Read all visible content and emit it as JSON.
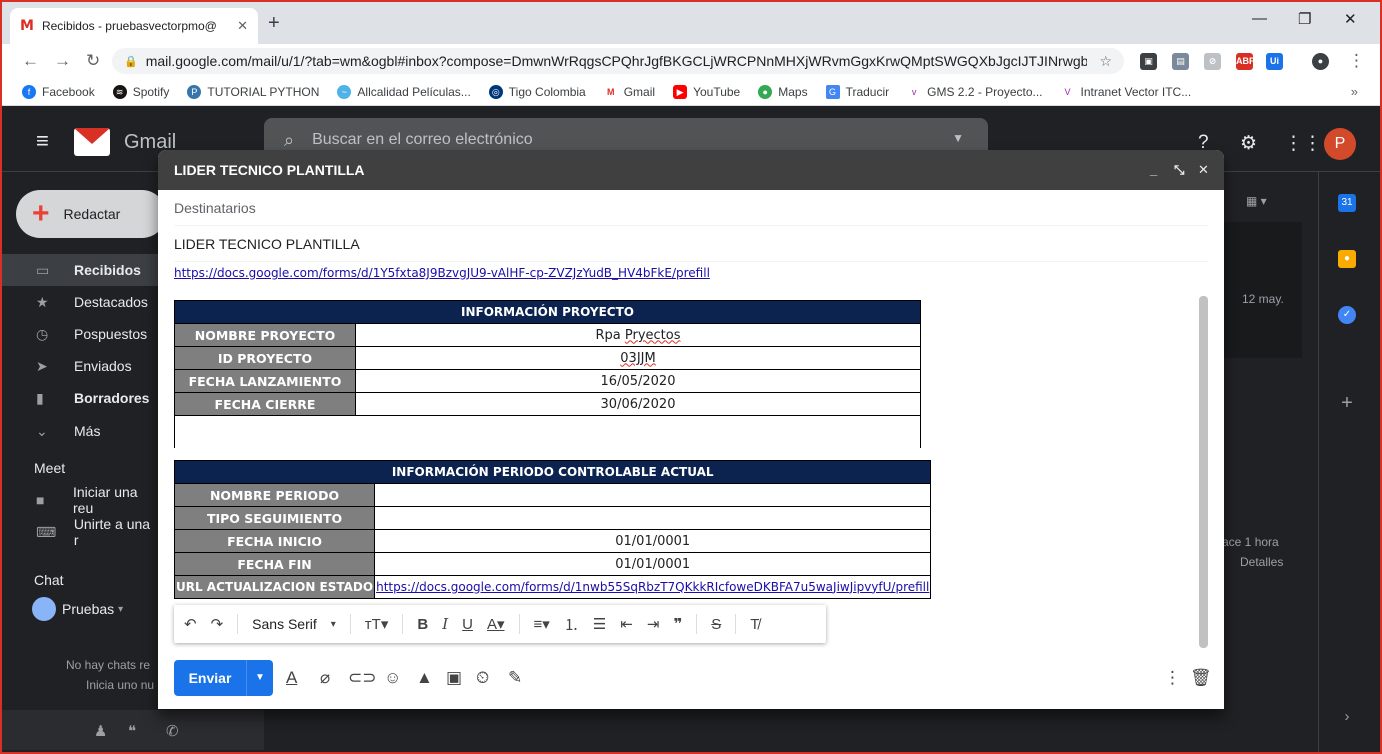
{
  "browser": {
    "tab_title": "Recibidos - pruebasvectorpmo@",
    "url": "mail.google.com/mail/u/1/?tab=wm&ogbl#inbox?compose=DmwnWrRqgsCPQhrJgfBKGCLjWRCPNnMHXjWRvmGgxKrwQMptSWGQXbJgcIJTJINrwgb...",
    "bookmarks": [
      "Facebook",
      "Spotify",
      "TUTORIAL PYTHON",
      "Allcalidad Películas...",
      "Tigo Colombia",
      "Gmail",
      "YouTube",
      "Maps",
      "Traducir",
      "GMS 2.2 - Proyecto...",
      "Intranet Vector ITC..."
    ],
    "bookmarks_more": "»"
  },
  "gmail": {
    "logo_text": "Gmail",
    "search_placeholder": "Buscar en el correo electrónico",
    "avatar_letter": "P",
    "compose_label": "Redactar",
    "nav": [
      "Recibidos",
      "Destacados",
      "Pospuestos",
      "Enviados",
      "Borradores",
      "Más"
    ],
    "meet_title": "Meet",
    "meet_items": [
      "Iniciar una reu",
      "Unirte a una r"
    ],
    "chat_title": "Chat",
    "chat_user": "Pruebas",
    "no_chats_1": "No hay chats re",
    "no_chats_2": "Inicia uno nu",
    "mail_date": "12 may.",
    "mail_time": "ace 1 hora",
    "mail_details": "Detalles"
  },
  "compose": {
    "title": "LIDER TECNICO PLANTILLA",
    "to_label": "Destinatarios",
    "subject": "LIDER TECNICO PLANTILLA",
    "top_link": "https://docs.google.com/forms/d/1Y5fxta8J9BzvgJU9-vAlHF-cp-ZVZJzYudB_HV4bFkE/prefill",
    "project_header": "INFORMACIÓN PROYECTO",
    "project_rows": [
      {
        "label": "NOMBRE PROYECTO",
        "value_a": "Rpa ",
        "value_b": "Pryectos"
      },
      {
        "label": "ID PROYECTO",
        "value_a": "",
        "value_b": "03JJM"
      },
      {
        "label": "FECHA LANZAMIENTO",
        "value_a": "16/05/2020",
        "value_b": ""
      },
      {
        "label": "FECHA CIERRE",
        "value_a": "30/06/2020",
        "value_b": ""
      }
    ],
    "period_header": "INFORMACIÓN PERIODO CONTROLABLE ACTUAL",
    "period_rows": [
      {
        "label": "NOMBRE PERIODO",
        "value": ""
      },
      {
        "label": "TIPO SEGUIMIENTO",
        "value": ""
      },
      {
        "label": "FECHA INICIO",
        "value": "01/01/0001"
      },
      {
        "label": "FECHA FIN",
        "value": "01/01/0001"
      }
    ],
    "url_label": "URL ACTUALIZACION ESTADO",
    "url_value": "https://docs.google.com/forms/d/1nwb55SqRbzT7QKkkRIcfoweDKBFA7u5waJiwJipvyfU/prefill",
    "font_name": "Sans Serif",
    "send_label": "Enviar"
  },
  "colors": {
    "table_header_bg": "#0c2350",
    "label_bg": "#7f7f7f",
    "send_blue": "#1a73e8",
    "window_border": "#d93025"
  }
}
